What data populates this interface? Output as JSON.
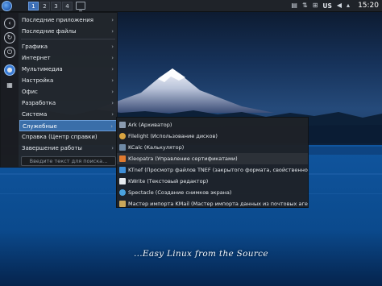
{
  "panel": {
    "pager": [
      "1",
      "2",
      "3",
      "4"
    ],
    "active_desktop": "1",
    "keyboard_layout": "US",
    "clock": "15:20"
  },
  "menu": {
    "items": [
      {
        "label": "Последние приложения",
        "arrow": "›"
      },
      {
        "label": "Последние файлы",
        "arrow": "›"
      },
      {
        "label": "Графика",
        "arrow": "›"
      },
      {
        "label": "Интернет",
        "arrow": "›"
      },
      {
        "label": "Мультимедиа",
        "arrow": "›"
      },
      {
        "label": "Настройка",
        "arrow": "›"
      },
      {
        "label": "Офис",
        "arrow": "›"
      },
      {
        "label": "Разработка",
        "arrow": "›"
      },
      {
        "label": "Система",
        "arrow": "›"
      },
      {
        "label": "Служебные",
        "arrow": "›"
      },
      {
        "label": "Справка (Центр справки)",
        "arrow": ""
      },
      {
        "label": "Завершение работы",
        "arrow": "›"
      }
    ],
    "search_placeholder": "Введите текст для поиска..."
  },
  "submenu": {
    "items": [
      {
        "label": "Ark (Архиватор)",
        "icon": "archive-icon",
        "color": "#8a9bb0"
      },
      {
        "label": "Filelight (Использование дисков)",
        "icon": "disk-usage-icon",
        "color": "#d9a441"
      },
      {
        "label": "KCalc (Калькулятор)",
        "icon": "calculator-icon",
        "color": "#6f8aa6"
      },
      {
        "label": "Kleopatra (Управление сертификатами)",
        "icon": "certificate-icon",
        "color": "#e07a2f"
      },
      {
        "label": "KTnef (Просмотр файлов TNEF (закрытого формата, свойственного outlook))",
        "icon": "mail-attachment-icon",
        "color": "#3f8fd8"
      },
      {
        "label": "KWrite (Текстовый редактор)",
        "icon": "text-editor-icon",
        "color": "#e8ecf0"
      },
      {
        "label": "Spectacle (Создание снимков экрана)",
        "icon": "screenshot-icon",
        "color": "#4aa3df"
      },
      {
        "label": "Мастер импорта KMail (Мастер импорта данных из почтовых агентов, таки...",
        "icon": "mail-import-icon",
        "color": "#c9a75a"
      }
    ]
  },
  "wallpaper": {
    "slogan": "...Easy Linux from the Source"
  },
  "colors": {
    "accent": "#3a6ea9",
    "panel_bg": "#1f2329",
    "menu_bg": "#22262c"
  }
}
